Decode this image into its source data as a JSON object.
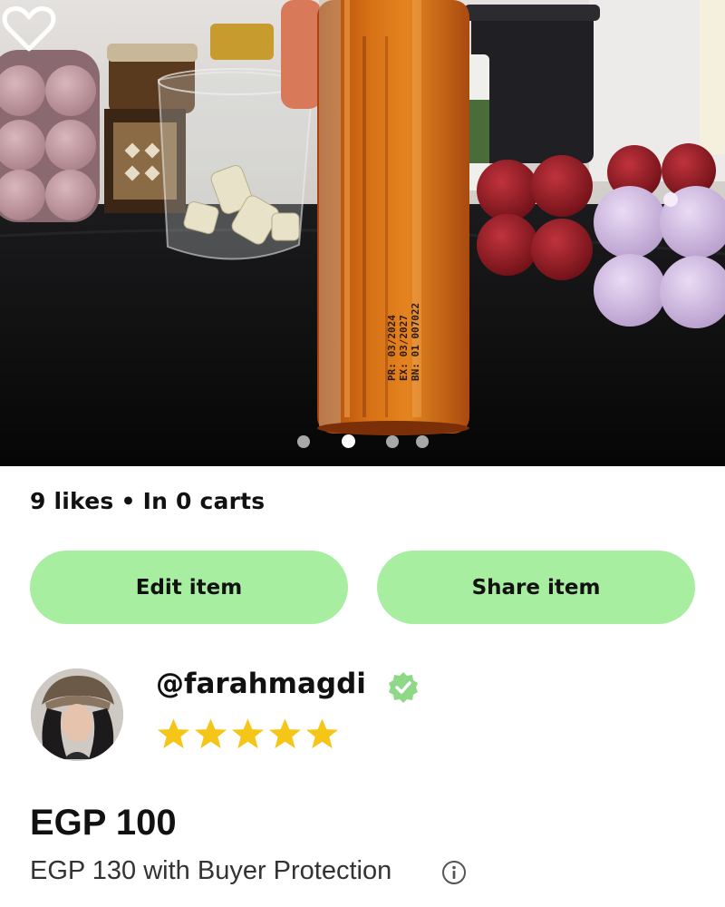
{
  "listing": {
    "photo": {
      "description_icon": "product-photo"
    },
    "carousel": {
      "count": 4,
      "active_index": 1
    },
    "likes_label": "9 likes",
    "separator": "•",
    "carts_label": "In 0 carts",
    "liked": false
  },
  "actions": {
    "edit_label": "Edit item",
    "share_label": "Share item",
    "button_color": "#a8eea0"
  },
  "seller": {
    "username": "@farahmagdi",
    "verified": true,
    "verified_color": "#8fd888",
    "rating": 5,
    "star_color": "#f5c518"
  },
  "pricing": {
    "price": "EGP 100",
    "buyer_protection": "EGP 130 with Buyer Protection",
    "info_icon": "info-icon"
  },
  "bottle_label": {
    "line1": "PR: 03/2024",
    "line2": "EX: 03/2027",
    "line3": "BN: 01 007022"
  }
}
